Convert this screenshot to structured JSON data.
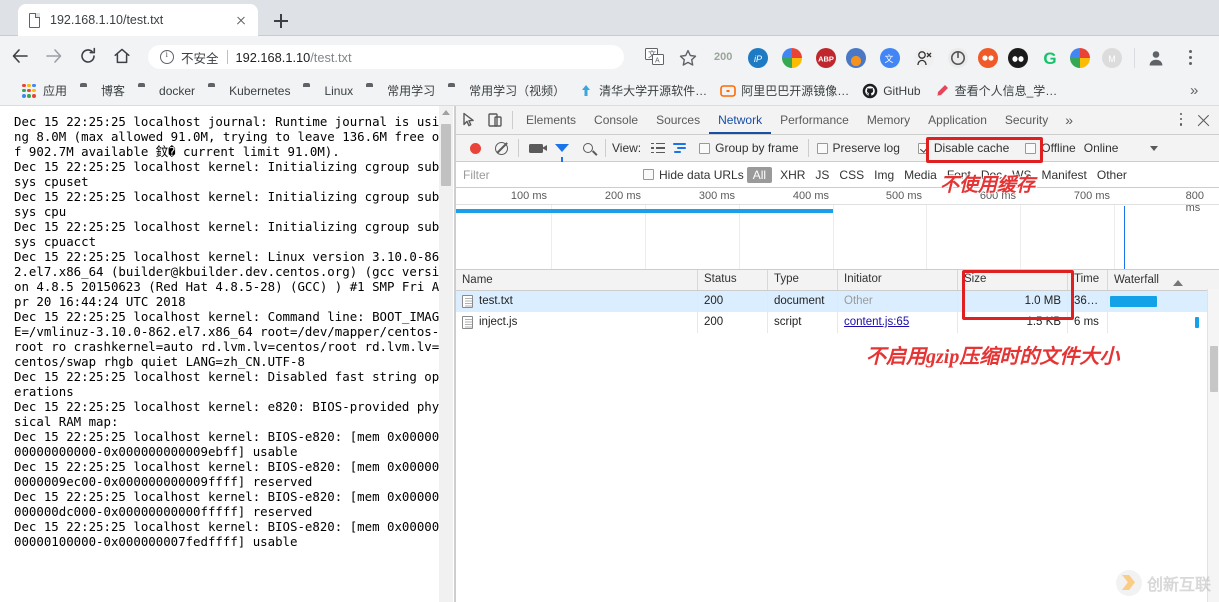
{
  "browser": {
    "tab": {
      "title": "192.168.1.10/test.txt",
      "favicon_icon": "document-icon",
      "close_icon": "close-icon"
    },
    "new_tab_icon": "plus-icon",
    "nav": {
      "back_icon": "arrow-left-icon",
      "forward_icon": "arrow-right-icon",
      "reload_icon": "reload-icon",
      "home_icon": "home-icon"
    },
    "omnibox": {
      "security_icon": "info-circle-icon",
      "security_label": "不安全",
      "url_host": "192.168.1.10",
      "url_path": "/test.txt"
    },
    "toolbar": {
      "translate_icon": "translate-icon",
      "bookmark_star_icon": "star-icon",
      "counter_badge": "200",
      "profile_icon": "avatar-icon",
      "menu_icon": "kebab-menu-icon",
      "extensions": [
        {
          "name": "ip-extension-icon",
          "label": "iP",
          "color": "#1f7ac4",
          "text_color": "#ffffff"
        },
        {
          "name": "chrome-extension-icon",
          "label": "",
          "color": "#e8492f",
          "text_color": "#ffffff"
        },
        {
          "name": "adblock-plus-icon",
          "label": "ABP",
          "color": "#c0272d",
          "text_color": "#ffffff"
        },
        {
          "name": "firefox-like-extension-icon",
          "label": "",
          "color": "#4a78c4",
          "text_color": "#ffffff"
        },
        {
          "name": "google-translate-extension-icon",
          "label": "G",
          "color": "#4285f4",
          "text_color": "#ffffff"
        },
        {
          "name": "user-script-extension-icon",
          "label": "",
          "color": "#f0f0f0",
          "text_color": "#333333"
        },
        {
          "name": "loop-extension-icon",
          "label": "",
          "color": "#ebebeb",
          "text_color": "#555555"
        },
        {
          "name": "infinity-extension-icon",
          "label": "",
          "color": "#f05a28",
          "text_color": "#ffffff"
        },
        {
          "name": "panda-extension-icon",
          "label": "",
          "color": "#1b1b1b",
          "text_color": "#ffffff"
        },
        {
          "name": "grammarly-extension-icon",
          "label": "G",
          "color": "#15c26b",
          "text_color": "#ffffff"
        },
        {
          "name": "chrome-profile-extension-icon",
          "label": "",
          "color": "#e8492f",
          "text_color": "#ffffff"
        },
        {
          "name": "momentum-extension-icon",
          "label": "M",
          "color": "#d8d8d8",
          "text_color": "#ffffff"
        }
      ]
    },
    "bookmarks": {
      "apps_label": "应用",
      "apps_icon": "apps-grid-icon",
      "overflow_icon": "chevron-double-right-icon",
      "items": [
        {
          "label": "博客",
          "icon": "folder-icon"
        },
        {
          "label": "docker",
          "icon": "folder-icon"
        },
        {
          "label": "Kubernetes",
          "icon": "folder-icon"
        },
        {
          "label": "Linux",
          "icon": "folder-icon"
        },
        {
          "label": "常用学习",
          "icon": "folder-icon"
        },
        {
          "label": "常用学习（视频）",
          "icon": "folder-icon"
        },
        {
          "label": "清华大学开源软件…",
          "icon": "tsinghua-mirror-icon"
        },
        {
          "label": "阿里巴巴开源镜像…",
          "icon": "alibaba-mirror-icon"
        },
        {
          "label": "GitHub",
          "icon": "github-icon"
        },
        {
          "label": "查看个人信息_学…",
          "icon": "bookmark-pen-icon"
        }
      ]
    }
  },
  "page": {
    "log": "Dec 15 22:25:25 localhost journal: Runtime journal is using 8.0M (max allowed 91.0M, trying to leave 136.6M free of 902.7M available 鈫� current limit 91.0M).\nDec 15 22:25:25 localhost kernel: Initializing cgroup subsys cpuset\nDec 15 22:25:25 localhost kernel: Initializing cgroup subsys cpu\nDec 15 22:25:25 localhost kernel: Initializing cgroup subsys cpuacct\nDec 15 22:25:25 localhost kernel: Linux version 3.10.0-862.el7.x86_64 (builder@kbuilder.dev.centos.org) (gcc version 4.8.5 20150623 (Red Hat 4.8.5-28) (GCC) ) #1 SMP Fri Apr 20 16:44:24 UTC 2018\nDec 15 22:25:25 localhost kernel: Command line: BOOT_IMAGE=/vmlinuz-3.10.0-862.el7.x86_64 root=/dev/mapper/centos-root ro crashkernel=auto rd.lvm.lv=centos/root rd.lvm.lv=centos/swap rhgb quiet LANG=zh_CN.UTF-8\nDec 15 22:25:25 localhost kernel: Disabled fast string operations\nDec 15 22:25:25 localhost kernel: e820: BIOS-provided physical RAM map:\nDec 15 22:25:25 localhost kernel: BIOS-e820: [mem 0x0000000000000000-0x000000000009ebff] usable\nDec 15 22:25:25 localhost kernel: BIOS-e820: [mem 0x000000000009ec00-0x000000000009ffff] reserved\nDec 15 22:25:25 localhost kernel: BIOS-e820: [mem 0x00000000000dc000-0x00000000000fffff] reserved\nDec 15 22:25:25 localhost kernel: BIOS-e820: [mem 0x0000000000100000-0x000000007fedffff] usable"
  },
  "devtools": {
    "inspect_icon": "inspect-element-icon",
    "device_toolbar_icon": "device-toolbar-icon",
    "tabs": [
      {
        "label": "Elements",
        "active": false
      },
      {
        "label": "Console",
        "active": false
      },
      {
        "label": "Sources",
        "active": false
      },
      {
        "label": "Network",
        "active": true
      },
      {
        "label": "Performance",
        "active": false
      },
      {
        "label": "Memory",
        "active": false
      },
      {
        "label": "Application",
        "active": false
      },
      {
        "label": "Security",
        "active": false
      }
    ],
    "more_tabs_icon": "chevron-double-right-icon",
    "settings_icon": "kebab-menu-icon",
    "close_icon": "close-icon",
    "network_toolbar": {
      "record_icon": "record-circle-icon",
      "clear_icon": "clear-prohibited-icon",
      "screenshot_icon": "camera-icon",
      "filter_icon": "funnel-filter-icon",
      "search_icon": "search-icon",
      "view_label": "View:",
      "view_list_icon": "list-view-icon",
      "view_waterfall_icon": "waterfall-view-icon",
      "group_by_frame_label": "Group by frame",
      "group_by_frame_checked": false,
      "preserve_log_label": "Preserve log",
      "preserve_log_checked": false,
      "disable_cache_label": "Disable cache",
      "disable_cache_checked": true,
      "offline_label": "Offline",
      "offline_checked": false,
      "throttling_label": "Online",
      "throttling_caret_icon": "caret-down-icon"
    },
    "filter_bar": {
      "filter_placeholder": "Filter",
      "filter_value": "",
      "hide_data_urls_label": "Hide data URLs",
      "hide_data_urls_checked": false,
      "types": [
        "All",
        "XHR",
        "JS",
        "CSS",
        "Img",
        "Media",
        "Font",
        "Doc",
        "WS",
        "Manifest",
        "Other"
      ],
      "active_type": "All"
    },
    "overview": {
      "ticks": [
        "100 ms",
        "200 ms",
        "300 ms",
        "400 ms",
        "500 ms",
        "600 ms",
        "700 ms",
        "800 ms"
      ],
      "axis_max_ms": 800,
      "bar_end_ms": 400,
      "marker_ms": 710
    },
    "request_table": {
      "columns": [
        "Name",
        "Status",
        "Type",
        "Initiator",
        "Size",
        "Time",
        "Waterfall"
      ],
      "sort_icon": "sort-ascending-icon",
      "rows": [
        {
          "name": "test.txt",
          "icon": "document-file-icon",
          "status": "200",
          "type": "document",
          "initiator": "Other",
          "initiator_is_link": false,
          "size": "1.0 MB",
          "time": "36…",
          "selected": true,
          "waterfall_start_pct": 2,
          "waterfall_width_pct": 48
        },
        {
          "name": "inject.js",
          "icon": "script-file-icon",
          "status": "200",
          "type": "script",
          "initiator": "content.js:65",
          "initiator_is_link": true,
          "size": "1.5 KB",
          "time": "6 ms",
          "selected": false,
          "waterfall_start_pct": 92,
          "waterfall_width_pct": 4
        }
      ]
    }
  },
  "annotations": [
    {
      "name": "disable-cache-annotation",
      "text": "不使用缓存"
    },
    {
      "name": "size-column-annotation",
      "text": "不启用gzip压缩时的文件大小"
    }
  ],
  "watermark": {
    "text": "创新互联",
    "logo_icon": "chuangxin-hulian-logo-icon"
  },
  "colors": {
    "devtools_accent": "#174ea6",
    "waterfall_bar": "#13a2e8",
    "annotation_red": "#e63434",
    "record_red": "#e8443a",
    "selected_row": "#dbeeff"
  }
}
